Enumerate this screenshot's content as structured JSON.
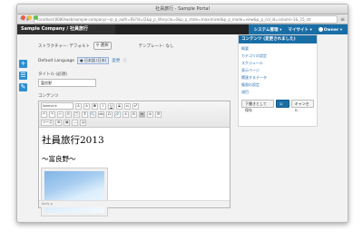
{
  "window": {
    "title": "社員旅行 - Sample Portal"
  },
  "browser": {
    "url": "localhost:8080/web/sample-company/~/p_p_auth=Rk?id=l2&p_p_lifecycle=0&p_p_state=maximized&p_p_mode=view&p_p_col_id=column-1&_15_str",
    "back": "◀",
    "forward": "▶"
  },
  "dockbar": {
    "site_name": "Sample Company / 社員旅行",
    "items": [
      "システム管理",
      "マイサイト",
      "Owner"
    ]
  },
  "left_tools": {
    "add": "+",
    "list": "☰",
    "edit": "✎"
  },
  "editor": {
    "structure_label": "ストラクチャー: デフォルト",
    "select_button": "選択",
    "template_label": "テンプレート: なし",
    "default_language_label": "Default Language",
    "default_language_value": "日本語 (日本)",
    "change_label": "変更",
    "title_label": "タイトル (必須)",
    "title_value": "富良野",
    "content_label": "コンテンツ",
    "format_combo": "Normal",
    "toolbar_row1": [
      "B",
      "I",
      "U",
      "S",
      "x₂",
      "x²"
    ],
    "toolbar_row2": [
      "↶",
      "↷",
      "✂",
      "⎘",
      "📋",
      "𝐓",
      "🔍",
      "ab",
      "Ω",
      "🔗",
      "⚓",
      "⊟",
      "≡",
      "≣",
      "☰"
    ],
    "toolbar_row3": [
      "⊞",
      "▦",
      "—",
      "☺"
    ],
    "source_label": "ソース",
    "doc_title": "社員旅行2013",
    "doc_subtitle": "〜富良野〜",
    "status_text": "body p"
  },
  "panel": {
    "header": "コンテンツ (変更されました)",
    "links": [
      "概要",
      "カテゴリの設定",
      "スケジュール",
      "表示ページ",
      "関連するデータ",
      "権限の設定",
      "項目"
    ],
    "save_draft": "下書きとして保存",
    "publish": "公開",
    "cancel": "キャンセル"
  }
}
